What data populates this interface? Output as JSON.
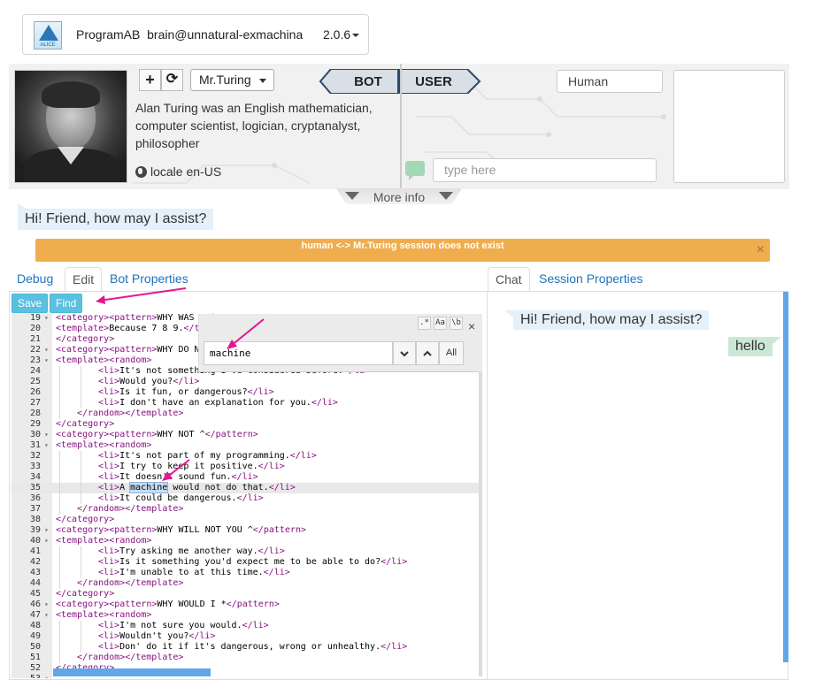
{
  "header": {
    "logo_text": "ALICE",
    "title": "ProgramAB",
    "brain": "brain@unnatural-exmachina",
    "version": "2.0.6"
  },
  "bot_panel": {
    "add_icon": "plus-icon",
    "refresh_icon": "refresh-icon",
    "bot_select": "Mr.Turing",
    "description": "Alan Turing was an English mathematician, computer scientist, logician, cryptanalyst, philosopher",
    "locale": "locale en-US",
    "bot_label": "BOT",
    "user_label": "USER",
    "human_field": "Human",
    "type_placeholder": "type here",
    "more_info": "More info"
  },
  "greeting": "Hi! Friend, how may I assist?",
  "alert": {
    "message": "human <-> Mr.Turing session does not exist",
    "close": "×"
  },
  "left_tabs": [
    "Debug",
    "Edit",
    "Bot Properties"
  ],
  "right_tabs": [
    "Chat",
    "Session Properties"
  ],
  "editor": {
    "save_label": "Save",
    "find_label": "Find",
    "search": {
      "value": "machine",
      "opt_regex": ".*",
      "opt_case": "Aa",
      "opt_word": "\\b",
      "all_label": "All",
      "close": "×",
      "up_icon": "chevron-up-icon",
      "down_icon": "chevron-down-icon"
    },
    "lines": [
      {
        "n": "19",
        "fold": true,
        "indent": 0,
        "text": "<category><pattern>WHY WAS * ^</pattern>"
      },
      {
        "n": "20",
        "fold": false,
        "indent": 0,
        "text": "<template>Because 7 8 9.</template>"
      },
      {
        "n": "21",
        "fold": false,
        "indent": 0,
        "text": "</category>"
      },
      {
        "n": "22",
        "fold": true,
        "indent": 0,
        "text": "<category><pattern>WHY DO NOT YOU ^</pattern>"
      },
      {
        "n": "23",
        "fold": true,
        "indent": 0,
        "text": "<template><random>"
      },
      {
        "n": "24",
        "fold": false,
        "indent": 2,
        "text": "<li>It's not something I've considered before.</li>"
      },
      {
        "n": "25",
        "fold": false,
        "indent": 2,
        "text": "<li>Would you?</li>"
      },
      {
        "n": "26",
        "fold": false,
        "indent": 2,
        "text": "<li>Is it fun, or dangerous?</li>"
      },
      {
        "n": "27",
        "fold": false,
        "indent": 2,
        "text": "<li>I don't have an explanation for you.</li>"
      },
      {
        "n": "28",
        "fold": false,
        "indent": 1,
        "text": "</random></template>"
      },
      {
        "n": "29",
        "fold": false,
        "indent": 0,
        "text": "</category>"
      },
      {
        "n": "30",
        "fold": true,
        "indent": 0,
        "text": "<category><pattern>WHY NOT ^</pattern>"
      },
      {
        "n": "31",
        "fold": true,
        "indent": 0,
        "text": "<template><random>"
      },
      {
        "n": "32",
        "fold": false,
        "indent": 2,
        "text": "<li>It's not part of my programming.</li>"
      },
      {
        "n": "33",
        "fold": false,
        "indent": 2,
        "text": "<li>I try to keep it positive.</li>"
      },
      {
        "n": "34",
        "fold": false,
        "indent": 2,
        "text": "<li>It doesn't sound fun.</li>"
      },
      {
        "n": "35",
        "fold": false,
        "indent": 2,
        "text": "<li>A machine would not do that.</li>",
        "highlight": true
      },
      {
        "n": "36",
        "fold": false,
        "indent": 2,
        "text": "<li>It could be dangerous.</li>"
      },
      {
        "n": "37",
        "fold": false,
        "indent": 1,
        "text": "</random></template>"
      },
      {
        "n": "38",
        "fold": false,
        "indent": 0,
        "text": "</category>"
      },
      {
        "n": "39",
        "fold": true,
        "indent": 0,
        "text": "<category><pattern>WHY WILL NOT YOU ^</pattern>"
      },
      {
        "n": "40",
        "fold": true,
        "indent": 0,
        "text": "<template><random>"
      },
      {
        "n": "41",
        "fold": false,
        "indent": 2,
        "text": "<li>Try asking me another way.</li>"
      },
      {
        "n": "42",
        "fold": false,
        "indent": 2,
        "text": "<li>Is it something you'd expect me to be able to do?</li>"
      },
      {
        "n": "43",
        "fold": false,
        "indent": 2,
        "text": "<li>I'm unable to at this time.</li>"
      },
      {
        "n": "44",
        "fold": false,
        "indent": 1,
        "text": "</random></template>"
      },
      {
        "n": "45",
        "fold": false,
        "indent": 0,
        "text": "</category>"
      },
      {
        "n": "46",
        "fold": true,
        "indent": 0,
        "text": "<category><pattern>WHY WOULD I *</pattern>"
      },
      {
        "n": "47",
        "fold": true,
        "indent": 0,
        "text": "<template><random>"
      },
      {
        "n": "48",
        "fold": false,
        "indent": 2,
        "text": "<li>I'm not sure you would.</li>"
      },
      {
        "n": "49",
        "fold": false,
        "indent": 2,
        "text": "<li>Wouldn't you?</li>"
      },
      {
        "n": "50",
        "fold": false,
        "indent": 2,
        "text": "<li>Don' do it if it's dangerous, wrong or unhealthy.</li>"
      },
      {
        "n": "51",
        "fold": false,
        "indent": 1,
        "text": "</random></template>"
      },
      {
        "n": "52",
        "fold": false,
        "indent": 0,
        "text": "</category>"
      },
      {
        "n": "53",
        "fold": true,
        "indent": 0,
        "text": ""
      }
    ]
  },
  "chat": {
    "messages": [
      {
        "from": "bot",
        "text": "Hi! Friend, how may I assist?"
      },
      {
        "from": "user",
        "text": "hello"
      }
    ]
  },
  "colors": {
    "tab_link": "#1e73be",
    "button": "#5bc0de",
    "alert": "#f0ad4e",
    "annotation_arrow": "#e6158f",
    "xml_tag": "#881280"
  }
}
